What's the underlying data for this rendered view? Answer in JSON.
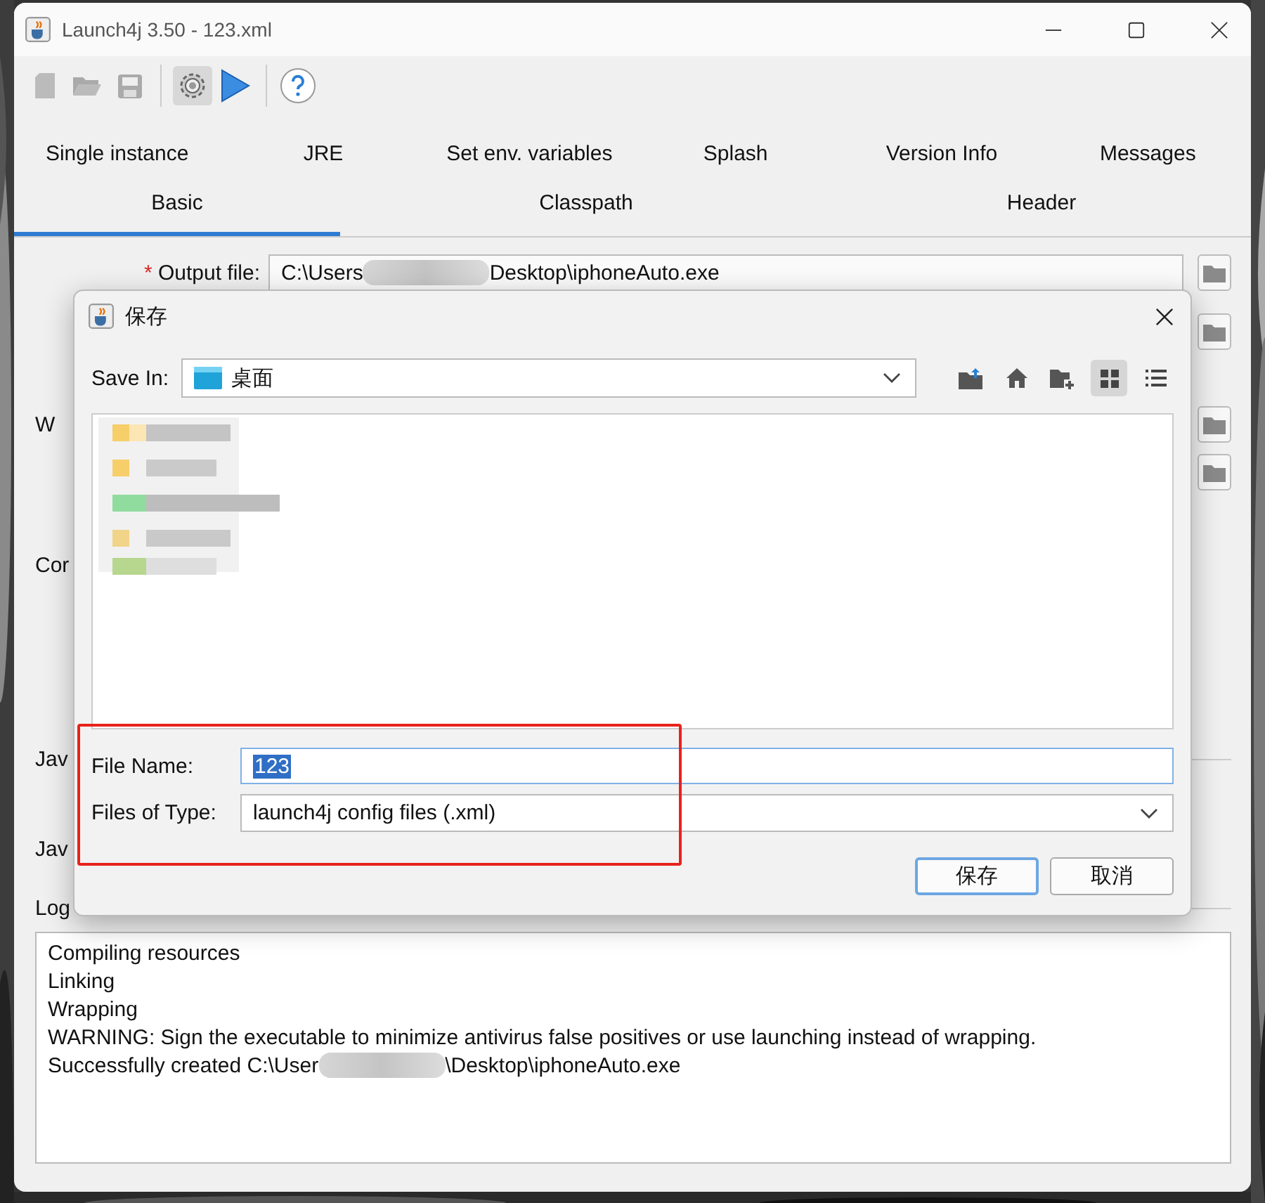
{
  "window": {
    "title": "Launch4j 3.50 - 123.xml"
  },
  "toolbar": [
    {
      "kind": "new",
      "selected": false
    },
    {
      "kind": "open",
      "selected": false
    },
    {
      "kind": "save",
      "selected": false
    },
    {
      "kind": "build",
      "selected": true
    },
    {
      "kind": "run",
      "selected": false
    },
    {
      "kind": "help",
      "selected": false
    }
  ],
  "tabs_row_1": [
    {
      "label": "Single instance",
      "selected": false
    },
    {
      "label": "JRE",
      "selected": false
    },
    {
      "label": "Set env. variables",
      "selected": false
    },
    {
      "label": "Splash",
      "selected": false
    },
    {
      "label": "Version Info",
      "selected": false
    },
    {
      "label": "Messages",
      "selected": false
    }
  ],
  "tabs_row_2": [
    {
      "label": "Basic",
      "selected": true
    },
    {
      "label": "Classpath",
      "selected": false
    },
    {
      "label": "Header",
      "selected": false
    }
  ],
  "form": {
    "output_file": {
      "label": "Output file:",
      "required_mark": "*",
      "value_parts": [
        "C:\\Users",
        "Desktop\\iphoneAuto.exe"
      ]
    },
    "partial_labels": [
      "W",
      "Cor",
      "Jav",
      "Jav"
    ],
    "log_label": "Log"
  },
  "log": {
    "lines": [
      [
        "Compiling resources"
      ],
      [
        "Linking"
      ],
      [
        "Wrapping"
      ],
      [
        "WARNING: Sign the executable to minimize antivirus false positives or use launching instead of wrapping."
      ],
      [
        "Successfully created C:\\User",
        "\\Desktop\\iphoneAuto.exe"
      ]
    ]
  },
  "dialog": {
    "title": "保存",
    "save_in_label": "Save In:",
    "save_in_value": "桌面",
    "view_buttons": [
      {
        "kind": "up",
        "selected": false
      },
      {
        "kind": "home",
        "selected": false
      },
      {
        "kind": "new-folder",
        "selected": false
      },
      {
        "kind": "list",
        "selected": true
      },
      {
        "kind": "details",
        "selected": false
      }
    ],
    "file_name_label": "File Name:",
    "file_name": {
      "value": "123",
      "selected": true
    },
    "type_label": "Files of Type:",
    "type_value": "launch4j config files (.xml)",
    "buttons": [
      {
        "label": "保存",
        "default": true
      },
      {
        "label": "取消",
        "default": false
      }
    ]
  }
}
